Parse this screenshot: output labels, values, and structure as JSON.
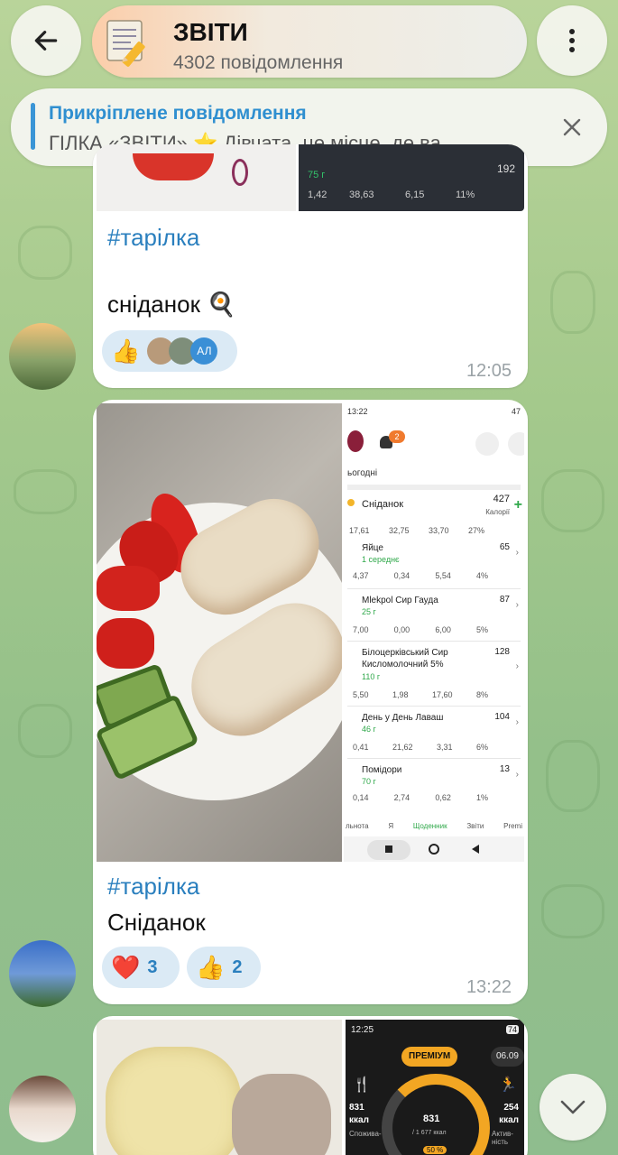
{
  "header": {
    "title": "ЗВІТИ",
    "subtitle": "4302 повідомлення"
  },
  "pinned": {
    "title": "Прикріплене повідомлення",
    "text": "ГІЛКА «ЗВІТИ» ⭐  Дівчата, це місце, де ва..."
  },
  "message1": {
    "macros_top": {
      "amount": "75 г",
      "kcal": "192",
      "v1": "1,42",
      "v2": "38,63",
      "v3": "6,15",
      "v4": "11%"
    },
    "hashtag": "#тарілка",
    "text": "сніданок 🍳",
    "reactions": [
      {
        "emoji": "👍"
      }
    ],
    "reactor_badge": "АЛ",
    "time": "12:05"
  },
  "message2": {
    "hashtag": "#тарілка",
    "text": "Сніданок",
    "reactions": [
      {
        "emoji": "❤️",
        "count": "3"
      },
      {
        "emoji": "👍",
        "count": "2"
      }
    ],
    "time": "13:22",
    "app": {
      "status_time": "13:22",
      "status_right": "47",
      "notif_count": "2",
      "day": "ьогодні",
      "meal": "Сніданок",
      "meal_kcal": "427",
      "meal_kcal_label": "Калорії",
      "meal_macros": [
        "17,61",
        "32,75",
        "33,70",
        "27%"
      ],
      "foods": [
        {
          "name": "Яйце",
          "amount": "1 середнє",
          "kcal": "65",
          "macros": [
            "4,37",
            "0,34",
            "5,54",
            "4%"
          ]
        },
        {
          "name": "Mlekpol Сир Гауда",
          "amount": "25 г",
          "kcal": "87",
          "macros": [
            "7,00",
            "0,00",
            "6,00",
            "5%"
          ]
        },
        {
          "name": "Білоцерківський Сир Кисломолочний 5%",
          "amount": "110 г",
          "kcal": "128",
          "macros": [
            "5,50",
            "1,98",
            "17,60",
            "8%"
          ]
        },
        {
          "name": "День у День Лаваш",
          "amount": "46 г",
          "kcal": "104",
          "macros": [
            "0,41",
            "21,62",
            "3,31",
            "6%"
          ]
        },
        {
          "name": "Помідори",
          "amount": "70 г",
          "kcal": "13",
          "macros": [
            "0,14",
            "2,74",
            "0,62",
            "1%"
          ]
        }
      ],
      "nav": [
        "льнота",
        "Я",
        "Щоденник",
        "Звіти",
        "Premi"
      ]
    }
  },
  "message3": {
    "app": {
      "status_time": "12:25",
      "status_right": "74",
      "premium": "ПРЕМІУМ",
      "date": "06.09",
      "left_kcal": "831",
      "left_unit": "ккал",
      "left_label": "Спожива-",
      "center_kcal": "831",
      "center_sub": "/ 1 677 ккал",
      "center_pct": "50 %",
      "right_kcal": "254",
      "right_unit": "ккал",
      "right_label": "Актив-ність"
    }
  },
  "colors": {
    "accent": "#2a7fbe",
    "reaction_bg": "#dbeaf5",
    "green": "#2fa84a"
  }
}
